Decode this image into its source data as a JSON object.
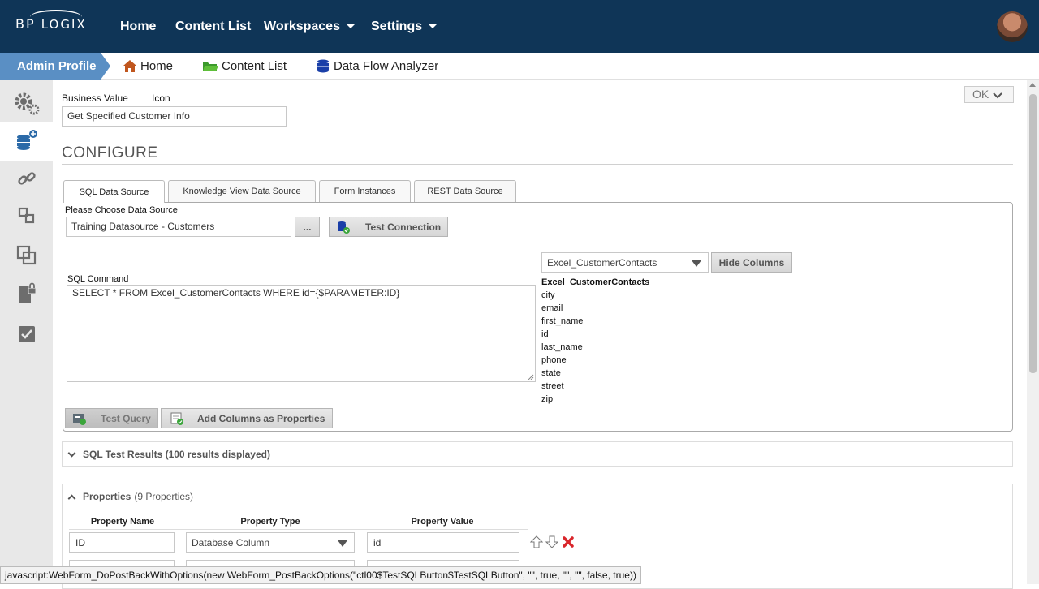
{
  "brand": {
    "logo_bp": "BP",
    "logo_rest": "LOGIX"
  },
  "topnav": {
    "items": [
      {
        "label": "Home"
      },
      {
        "label": "Content List"
      },
      {
        "label": "Workspaces"
      },
      {
        "label": "Settings"
      }
    ]
  },
  "subnav": {
    "profile": "Admin Profile",
    "items": [
      {
        "label": "Home",
        "icon": "house-icon"
      },
      {
        "label": "Content List",
        "icon": "folder-icon"
      },
      {
        "label": "Data Flow Analyzer",
        "icon": "database-icon"
      }
    ]
  },
  "rail": [
    "gears-icon",
    "database-add-icon",
    "link-icon",
    "steps-icon",
    "copy-icon",
    "document-lock-icon",
    "checklist-icon"
  ],
  "form": {
    "business_value_label": "Business Value",
    "icon_label": "Icon",
    "business_value": "Get Specified Customer Info",
    "ok_label": "OK",
    "configure_heading": "CONFIGURE"
  },
  "tabs": [
    {
      "label": "SQL Data Source",
      "active": true
    },
    {
      "label": "Knowledge View Data Source",
      "active": false
    },
    {
      "label": "Form Instances",
      "active": false
    },
    {
      "label": "REST Data Source",
      "active": false
    }
  ],
  "sql": {
    "choose_label": "Please Choose Data Source",
    "data_source": "Training Datasource - Customers",
    "ellipsis": "...",
    "test_connection": "Test Connection",
    "table_select": "Excel_CustomerContacts",
    "hide_columns": "Hide Columns",
    "command_label": "SQL Command",
    "command": "SELECT * FROM Excel_CustomerContacts WHERE id={$PARAMETER:ID}",
    "columns_header": "Excel_CustomerContacts",
    "columns": [
      "city",
      "email",
      "first_name",
      "id",
      "last_name",
      "phone",
      "state",
      "street",
      "zip"
    ],
    "test_query": "Test Query",
    "add_columns": "Add Columns as Properties"
  },
  "results": {
    "title": "SQL Test Results (100 results displayed)"
  },
  "properties": {
    "title": "Properties",
    "count": "(9 Properties)",
    "headers": [
      "Property Name",
      "Property Type",
      "Property Value"
    ],
    "row1": {
      "name": "ID",
      "type": "Database Column",
      "value": "id"
    }
  },
  "status_bar": "javascript:WebForm_DoPostBackWithOptions(new WebForm_PostBackOptions(\"ctl00$TestSQLButton$TestSQLButton\", \"\", true, \"\", \"\", false, true))",
  "colors": {
    "topbar": "#0f3557",
    "accent": "#5a8fc4",
    "delete": "#d9262b"
  }
}
